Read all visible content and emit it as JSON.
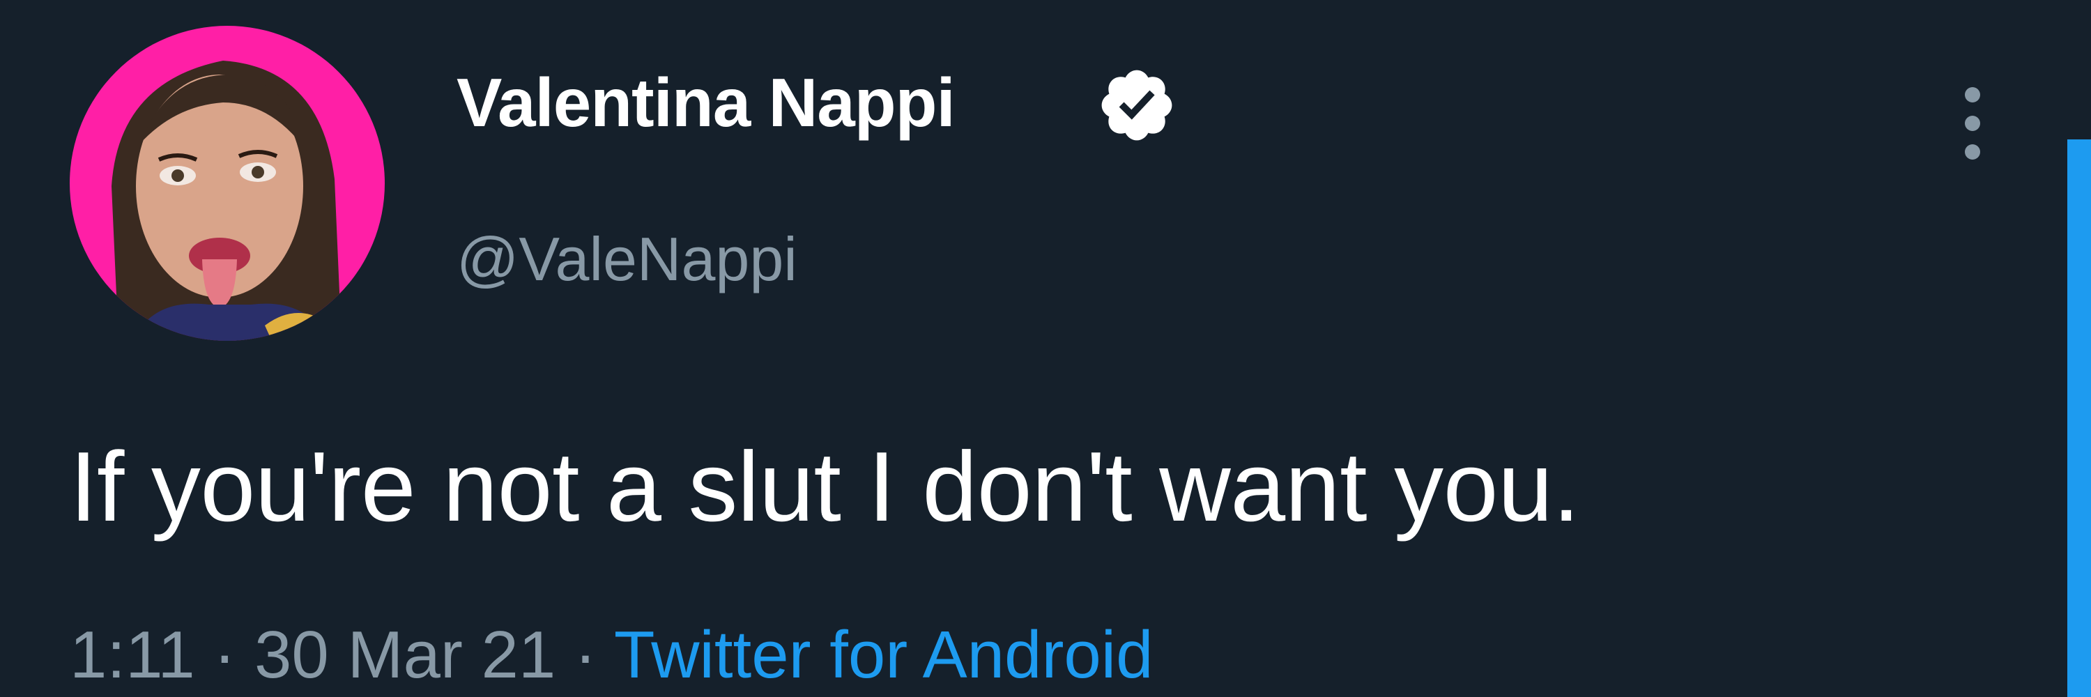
{
  "tweet": {
    "author": {
      "display_name": "Valentina Nappi",
      "handle": "@ValeNappi",
      "verified": true
    },
    "text": "If you're not a slut I don't want you.",
    "meta": {
      "time": "1:11",
      "separator": " · ",
      "date": "30 Mar 21",
      "source": "Twitter for Android"
    }
  },
  "icons": {
    "verified": "verified-badge-icon",
    "more": "more-options-icon"
  },
  "colors": {
    "background": "#15202b",
    "text_primary": "#ffffff",
    "text_secondary": "#8899a6",
    "link": "#1d9bf0",
    "avatar_background": "#ff1fa6"
  }
}
